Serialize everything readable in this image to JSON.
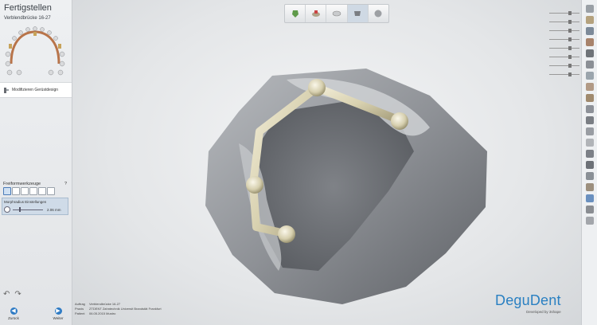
{
  "left_panel": {
    "title": "Fertigstellen",
    "subtitle": "Verblendbrücke 16-27",
    "modify_label": "Modifizieren Gerüstdesign",
    "tool_panel": {
      "title": "Freiformwerkzeuge",
      "morph_title": "Morphradius Einstellungen",
      "value": "2.06 mm"
    },
    "back_label": "Zurück",
    "next_label": "Weiter"
  },
  "info": {
    "order_label": "Auftrag",
    "order_value": "Verblendbrücke 16-27",
    "practice_label": "Praxis",
    "practice_value": "ZTDENT Zahntechnik Universit Brandstät Frankfurt",
    "patient_label": "Patient",
    "patient_value": "06.05.2015 Mustro"
  },
  "logo": {
    "brand": "DeguDent",
    "by": "Developed by 3shape"
  },
  "colors": {
    "accent": "#2a80c2",
    "framework": "#d8d1b0",
    "model": "#8e9196"
  },
  "icons": [
    "tooth-icon",
    "view-icon",
    "eye-icon",
    "solid-icon",
    "gloss-icon"
  ]
}
